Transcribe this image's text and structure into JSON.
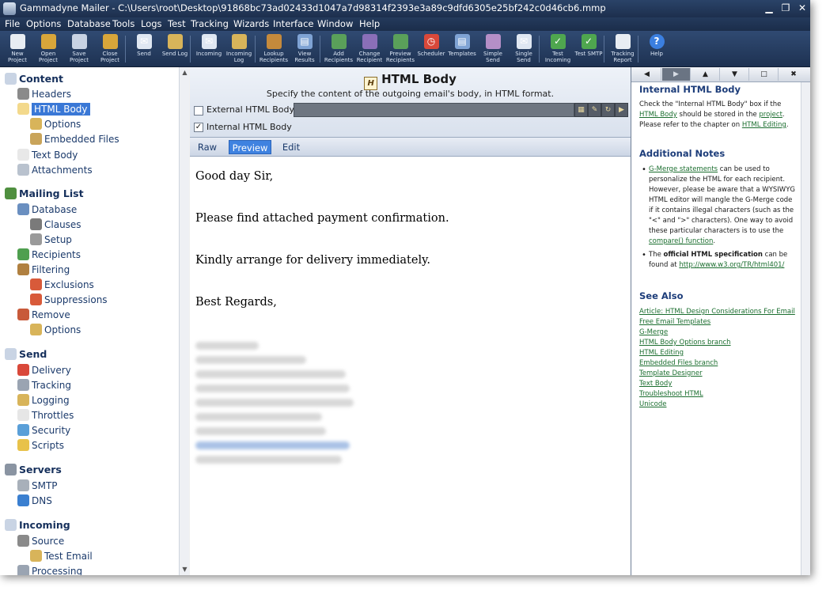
{
  "window": {
    "title": "Gammadyne Mailer - C:\\Users\\root\\Desktop\\91868bc73ad02433d1047a7d98314f2393e3a89c9dfd6305e25bf242c0d46cb6.mmp",
    "minimize": "▁",
    "restore": "❐",
    "close": "✕"
  },
  "menu": [
    "File",
    "Options",
    "Database",
    "Tools",
    "Logs",
    "Test",
    "Tracking",
    "Wizards",
    "Interface",
    "Window",
    "Help"
  ],
  "toolbar": [
    {
      "label": "New Project",
      "icon": "new-project-icon",
      "color": "#e8edf3"
    },
    {
      "label": "Open Project",
      "icon": "open-project-icon",
      "color": "#d8a63a"
    },
    {
      "label": "Save Project",
      "icon": "save-project-icon",
      "color": "#c8d3e4"
    },
    {
      "label": "Close Project",
      "icon": "close-project-icon",
      "color": "#d8a63a"
    },
    {
      "label": "Send",
      "icon": "send-icon",
      "color": "#dfe7f2"
    },
    {
      "label": "Send Log",
      "icon": "send-log-icon",
      "color": "#d8b45a"
    },
    {
      "label": "Incoming",
      "icon": "incoming-icon",
      "color": "#dfe7f2"
    },
    {
      "label": "Incoming Log",
      "icon": "incoming-log-icon",
      "color": "#d8b45a"
    },
    {
      "label": "Lookup Recipients",
      "icon": "lookup-recipients-icon",
      "color": "#c58a3c"
    },
    {
      "label": "View Results",
      "icon": "view-results-icon",
      "color": "#7fa3d4"
    },
    {
      "label": "Add Recipients",
      "icon": "add-recipients-icon",
      "color": "#5aa05a"
    },
    {
      "label": "Change Recipient",
      "icon": "change-recipient-icon",
      "color": "#8a6fb8"
    },
    {
      "label": "Preview Recipients",
      "icon": "preview-recipients-icon",
      "color": "#5aa05a"
    },
    {
      "label": "Scheduler",
      "icon": "scheduler-icon",
      "color": "#d9483a"
    },
    {
      "label": "Templates",
      "icon": "templates-icon",
      "color": "#7fa3d4"
    },
    {
      "label": "Simple Send",
      "icon": "simple-send-icon",
      "color": "#b58fc7"
    },
    {
      "label": "Single Send",
      "icon": "single-send-icon",
      "color": "#dfe7f2"
    },
    {
      "label": "Test Incoming",
      "icon": "test-incoming-icon",
      "color": "#4fa64f"
    },
    {
      "label": "Test SMTP",
      "icon": "test-smtp-icon",
      "color": "#4fa64f"
    },
    {
      "label": "Tracking Report",
      "icon": "tracking-report-icon",
      "color": "#e8edf3"
    },
    {
      "label": "Help",
      "icon": "help-icon",
      "color": "#3b7fe0"
    }
  ],
  "tree": [
    {
      "label": "Content",
      "icon": "content-envelope-icon",
      "level": 0,
      "section": true
    },
    {
      "label": "Headers",
      "icon": "headers-icon",
      "level": 1
    },
    {
      "label": "HTML Body",
      "icon": "html-body-icon",
      "level": 1,
      "selected": true
    },
    {
      "label": "Options",
      "icon": "options-icon",
      "level": 2
    },
    {
      "label": "Embedded Files",
      "icon": "embedded-files-icon",
      "level": 2
    },
    {
      "label": "Text Body",
      "icon": "text-body-icon",
      "level": 1
    },
    {
      "label": "Attachments",
      "icon": "attachments-icon",
      "level": 1
    },
    {
      "label": "Mailing List",
      "icon": "mailing-list-icon",
      "level": 0,
      "section": true
    },
    {
      "label": "Database",
      "icon": "database-icon",
      "level": 1
    },
    {
      "label": "Clauses",
      "icon": "clauses-icon",
      "level": 2
    },
    {
      "label": "Setup",
      "icon": "setup-icon",
      "level": 2
    },
    {
      "label": "Recipients",
      "icon": "recipients-icon",
      "level": 1
    },
    {
      "label": "Filtering",
      "icon": "filtering-icon",
      "level": 1
    },
    {
      "label": "Exclusions",
      "icon": "exclusions-icon",
      "level": 2
    },
    {
      "label": "Suppressions",
      "icon": "suppressions-icon",
      "level": 2
    },
    {
      "label": "Remove",
      "icon": "remove-icon",
      "level": 1
    },
    {
      "label": "Options",
      "icon": "remove-options-icon",
      "level": 2
    },
    {
      "label": "Send",
      "icon": "send-section-icon",
      "level": 0,
      "section": true
    },
    {
      "label": "Delivery",
      "icon": "delivery-icon",
      "level": 1
    },
    {
      "label": "Tracking",
      "icon": "tracking-icon",
      "level": 1
    },
    {
      "label": "Logging",
      "icon": "logging-icon",
      "level": 1
    },
    {
      "label": "Throttles",
      "icon": "throttles-icon",
      "level": 1
    },
    {
      "label": "Security",
      "icon": "security-icon",
      "level": 1
    },
    {
      "label": "Scripts",
      "icon": "scripts-icon",
      "level": 1
    },
    {
      "label": "Servers",
      "icon": "servers-icon",
      "level": 0,
      "section": true
    },
    {
      "label": "SMTP",
      "icon": "smtp-icon",
      "level": 1
    },
    {
      "label": "DNS",
      "icon": "dns-icon",
      "level": 1
    },
    {
      "label": "Incoming",
      "icon": "incoming-section-icon",
      "level": 0,
      "section": true
    },
    {
      "label": "Source",
      "icon": "source-icon",
      "level": 1
    },
    {
      "label": "Test Email",
      "icon": "test-email-icon",
      "level": 2
    },
    {
      "label": "Processing",
      "icon": "processing-icon",
      "level": 1
    }
  ],
  "panel": {
    "title": "HTML Body",
    "subtitle": "Specify the content of the outgoing email's body, in HTML format.",
    "external_label": "External HTML Body:",
    "external_checked": false,
    "external_value": "",
    "internal_label": "Internal HTML Body",
    "internal_checked": true,
    "tabs": [
      "Raw",
      "Preview",
      "Edit"
    ],
    "active_tab": "Preview"
  },
  "email": {
    "greeting": "Good day Sir,",
    "line1": "Please find attached payment confirmation.",
    "line2": "Kindly arrange for delivery immediately.",
    "closing": "Best Regards,"
  },
  "help": {
    "nav": [
      "◀",
      "▶",
      "▲",
      "▼",
      "□",
      "✖"
    ],
    "h1": "Internal HTML Body",
    "p1_a": "Check the \"Internal HTML Body\" box if the ",
    "p1_link1": "HTML Body",
    "p1_b": " should be stored in the ",
    "p1_link2": "project",
    "p1_c": ".  Please refer to the chapter on ",
    "p1_link3": "HTML Editing",
    "p1_d": ".",
    "h2": "Additional Notes",
    "n1_link": "G-Merge statements",
    "n1_text": " can be used to personalize the HTML for each recipient.  However, please be aware that a WYSIWYG HTML editor will mangle the G-Merge code if it contains illegal characters (such as the \"<\" and \">\" characters).  One way to avoid these particular characters is to use the ",
    "n1_link2": "compare() function",
    "n1_end": ".",
    "n2_a": "The ",
    "n2_bold": "official HTML specification",
    "n2_b": " can be found at ",
    "n2_link": "http://www.w3.org/TR/html401/",
    "h3": "See Also",
    "see_also": [
      "Article: HTML Design Considerations For Email",
      "Free Email Templates",
      "G-Merge",
      "HTML Body Options branch",
      "HTML Editing",
      "Embedded Files branch",
      "Template Designer",
      "Text Body",
      "Troubleshoot HTML",
      "Unicode"
    ]
  }
}
